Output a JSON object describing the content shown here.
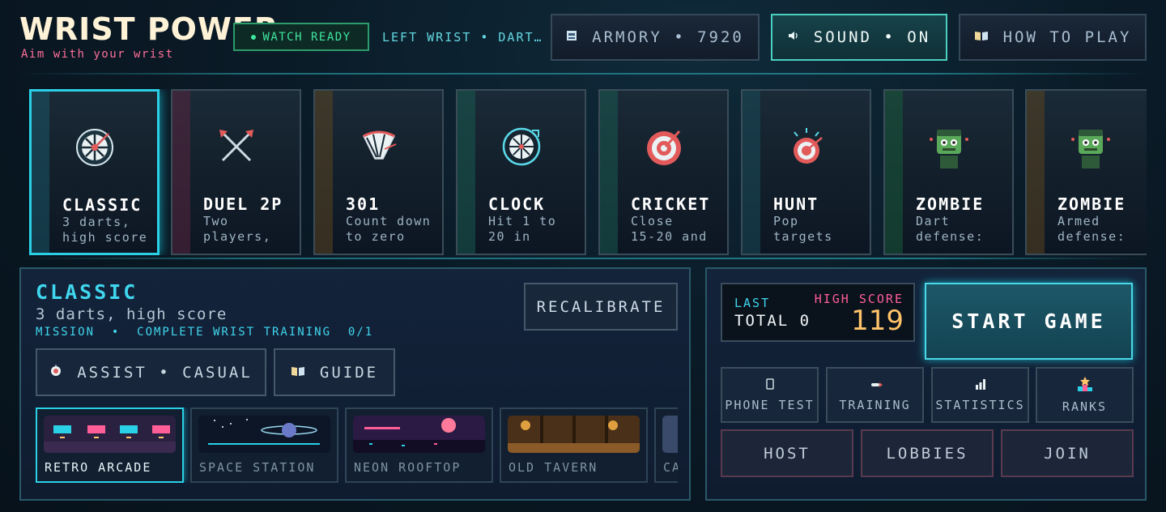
{
  "header": {
    "title": "WRIST POWER",
    "subtitle": "Aim with your wrist",
    "watch_status": "WATCH READY",
    "hand_info": "LEFT WRIST • DART…",
    "armory_label": "ARMORY • 7920",
    "sound_label": "SOUND • ON",
    "howto_label": "HOW TO PLAY"
  },
  "modes": [
    {
      "name": "CLASSIC",
      "desc": "3 darts,\nhigh score",
      "icon": "dartboard-icon",
      "accent": "#2ad0e6",
      "selected": true
    },
    {
      "name": "DUEL 2P",
      "desc": "Two\nplayers,",
      "icon": "crossed-darts-icon",
      "accent": "#c84c7c"
    },
    {
      "name": "301",
      "desc": "Count down\nto zero",
      "icon": "fan-board-icon",
      "accent": "#c8a04c"
    },
    {
      "name": "CLOCK",
      "desc": "Hit 1 to\n20 in",
      "icon": "clock-board-icon",
      "accent": "#2ab0a0"
    },
    {
      "name": "CRICKET",
      "desc": "Close\n15-20 and",
      "icon": "bullseye-icon",
      "accent": "#2ab0a0"
    },
    {
      "name": "HUNT",
      "desc": "Pop\ntargets",
      "icon": "target-burst-icon",
      "accent": "#2ab0c8"
    },
    {
      "name": "ZOMBIE",
      "desc": "Dart\ndefense:",
      "icon": "zombie-icon",
      "accent": "#4cb87c"
    },
    {
      "name": "ZOMBIE",
      "desc": "Armed\ndefense:",
      "icon": "zombie-icon",
      "accent": "#c8a04c"
    }
  ],
  "selected_mode": {
    "title": "CLASSIC",
    "subtitle": "3 darts, high score",
    "mission": "MISSION  •  COMPLETE WRIST TRAINING  0/1",
    "recalibrate_label": "RECALIBRATE",
    "assist_label": "ASSIST • CASUAL",
    "guide_label": "GUIDE"
  },
  "arenas": [
    {
      "name": "RETRO ARCADE",
      "selected": true
    },
    {
      "name": "SPACE STATION"
    },
    {
      "name": "NEON ROOFTOP"
    },
    {
      "name": "OLD TAVERN"
    },
    {
      "name": "CA"
    }
  ],
  "scores": {
    "last_label": "LAST",
    "total_label": "TOTAL 0",
    "high_label": "HIGH SCORE",
    "high_value": "119"
  },
  "actions": {
    "start_label": "START GAME",
    "phone_test": "PHONE TEST",
    "training": "TRAINING",
    "statistics": "STATISTICS",
    "ranks": "RANKS",
    "host": "HOST",
    "lobbies": "LOBBIES",
    "join": "JOIN"
  },
  "colors": {
    "accent": "#2ad0e6",
    "pink": "#ff5e97",
    "gold": "#ffc36a",
    "green": "#3fe6a0"
  }
}
